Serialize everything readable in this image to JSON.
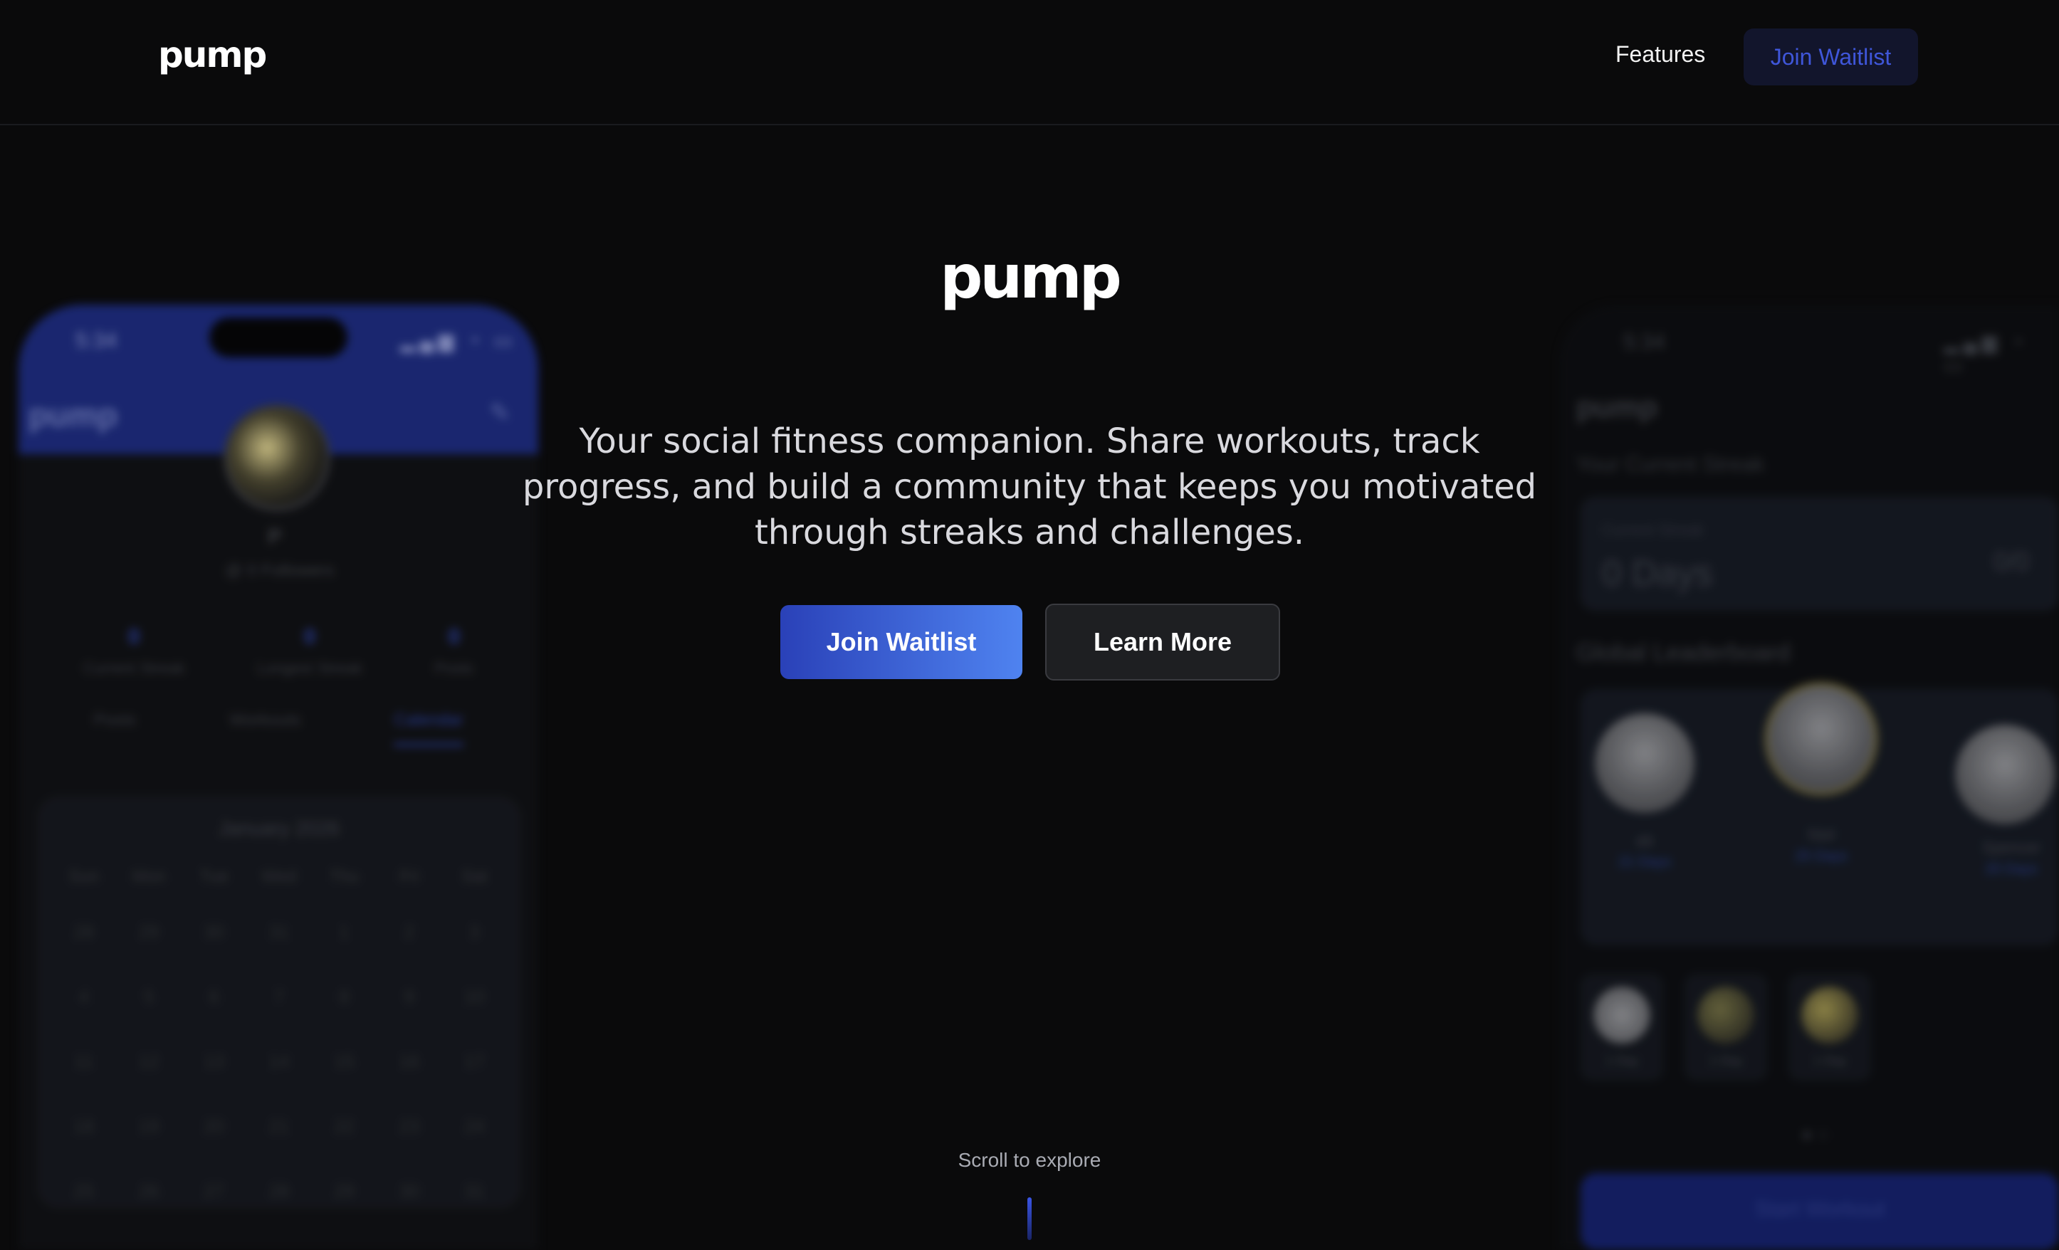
{
  "nav": {
    "logo": "pump",
    "features_label": "Features",
    "join_label": "Join Waitlist"
  },
  "hero": {
    "logo": "pump",
    "tagline": "Your social fitness companion. Share workouts, track progress, and build a community that keeps you motivated through streaks and challenges.",
    "join_label": "Join Waitlist",
    "learn_label": "Learn More",
    "scroll_hint": "Scroll to explore"
  },
  "phone_left": {
    "time": "5:34",
    "brand": "pump",
    "profile_name": "P",
    "profile_handle": "@ 0 Followers",
    "stats": [
      {
        "value": "0",
        "label": "Current Streak"
      },
      {
        "value": "0",
        "label": "Longest Streak"
      },
      {
        "value": "0",
        "label": "Posts"
      }
    ],
    "tabs": [
      "Posts",
      "Workouts",
      "Calendar"
    ],
    "calendar": {
      "title": "January 2026",
      "weekdays": [
        "Sun",
        "Mon",
        "Tue",
        "Wed",
        "Thu",
        "Fri",
        "Sat"
      ],
      "days": [
        "28",
        "29",
        "30",
        "31",
        "1",
        "2",
        "3",
        "4",
        "5",
        "6",
        "7",
        "8",
        "9",
        "10",
        "11",
        "12",
        "13",
        "14",
        "15",
        "16",
        "17",
        "18",
        "19",
        "20",
        "21",
        "22",
        "23",
        "24",
        "25",
        "26",
        "27",
        "28",
        "29",
        "30",
        "31"
      ]
    }
  },
  "phone_right": {
    "time": "5:34",
    "brand": "pump",
    "streak_title": "Your Current Streak",
    "streak_sub": "Current Streak",
    "streak_value": "0 Days",
    "streak_right": "0/0",
    "leaderboard_title": "Global Leaderboard",
    "leaders": [
      {
        "name": "ab",
        "days": "21 Days"
      },
      {
        "name": "Niel",
        "days": "25 Days"
      },
      {
        "name": "Spencer",
        "days": "20 Days"
      }
    ],
    "minis": [
      "1 Day",
      "1 Day",
      "1 Day"
    ],
    "start_label": "Start Workout"
  }
}
